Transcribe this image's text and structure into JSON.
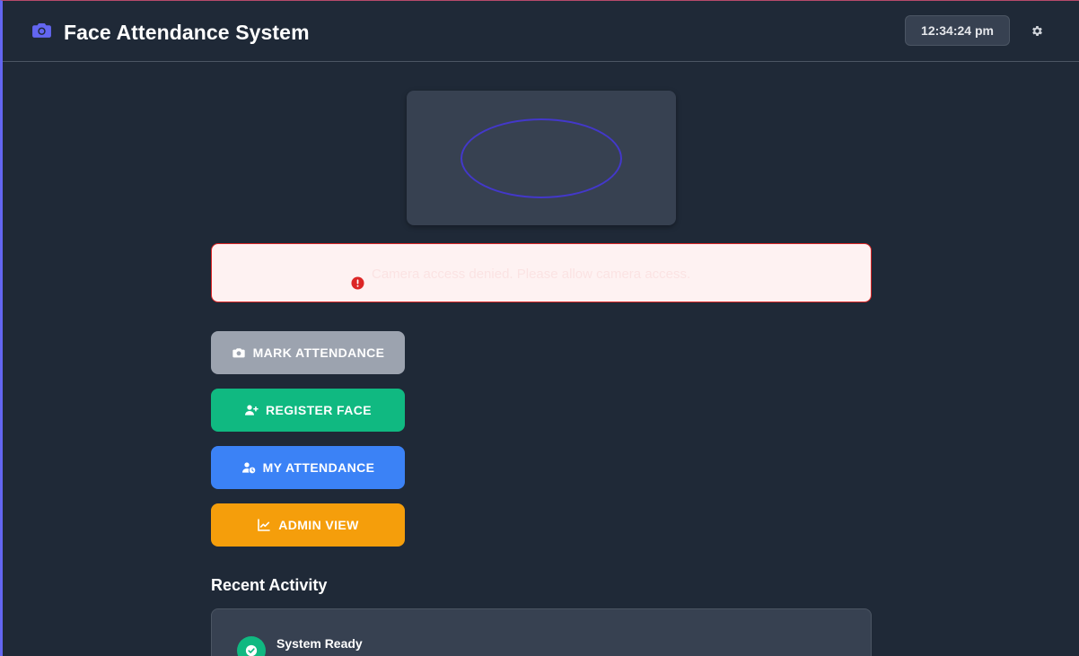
{
  "header": {
    "title": "Face Attendance System",
    "time": "12:34:24 pm",
    "brand_icon": "camera-icon",
    "settings_icon": "gear-icon"
  },
  "camera": {
    "overlay": "face-guide-oval"
  },
  "alert": {
    "icon": "exclamation-circle-icon",
    "message": "Camera access denied. Please allow camera access."
  },
  "actions": {
    "mark_attendance": "MARK ATTENDANCE",
    "register_face": "REGISTER FACE",
    "my_attendance": "MY ATTENDANCE",
    "admin_view": "ADMIN VIEW"
  },
  "recent_activity": {
    "title": "Recent Activity",
    "items": [
      {
        "title": "System Ready",
        "icon": "check-circle-icon"
      }
    ]
  },
  "colors": {
    "background": "#1f2937",
    "accent": "#6366f1",
    "mark": "#9ca3af",
    "register": "#10b981",
    "my_attendance": "#3b82f6",
    "admin": "#f59e0b",
    "alert_bg": "#fef2f2",
    "alert_border": "#dc2626"
  }
}
